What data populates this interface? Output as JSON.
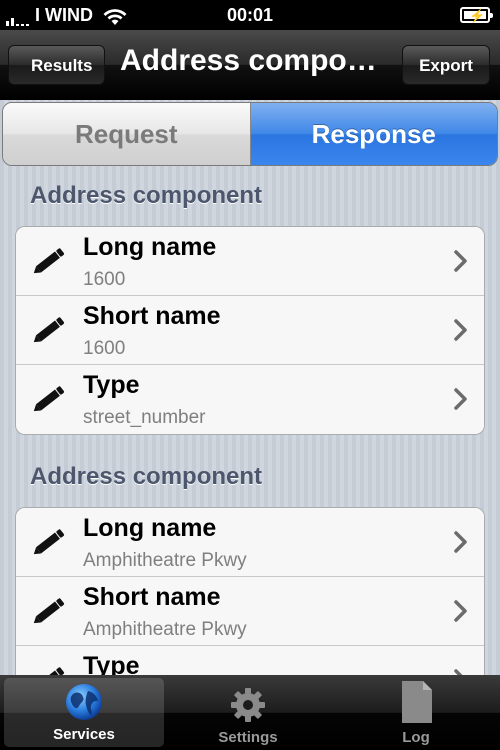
{
  "status": {
    "carrier": "I WIND",
    "time": "00:01"
  },
  "nav": {
    "back_label": "Results",
    "title": "Address compo…",
    "export_label": "Export"
  },
  "segments": {
    "request": "Request",
    "response": "Response",
    "selected": "Response"
  },
  "sections": [
    {
      "header": "Address component",
      "rows": [
        {
          "label": "Long name",
          "value": "1600"
        },
        {
          "label": "Short name",
          "value": "1600"
        },
        {
          "label": "Type",
          "value": "street_number"
        }
      ]
    },
    {
      "header": "Address component",
      "rows": [
        {
          "label": "Long name",
          "value": "Amphitheatre Pkwy"
        },
        {
          "label": "Short name",
          "value": "Amphitheatre Pkwy"
        },
        {
          "label": "Type",
          "value": ""
        }
      ]
    }
  ],
  "tabs": [
    {
      "label": "Services",
      "icon": "globe-icon",
      "selected": true
    },
    {
      "label": "Settings",
      "icon": "gear-icon",
      "selected": false
    },
    {
      "label": "Log",
      "icon": "document-icon",
      "selected": false
    }
  ],
  "colors": {
    "accent_blue": "#3f87e8",
    "section_header": "#4c566c",
    "value_gray": "#7f7f7f"
  }
}
